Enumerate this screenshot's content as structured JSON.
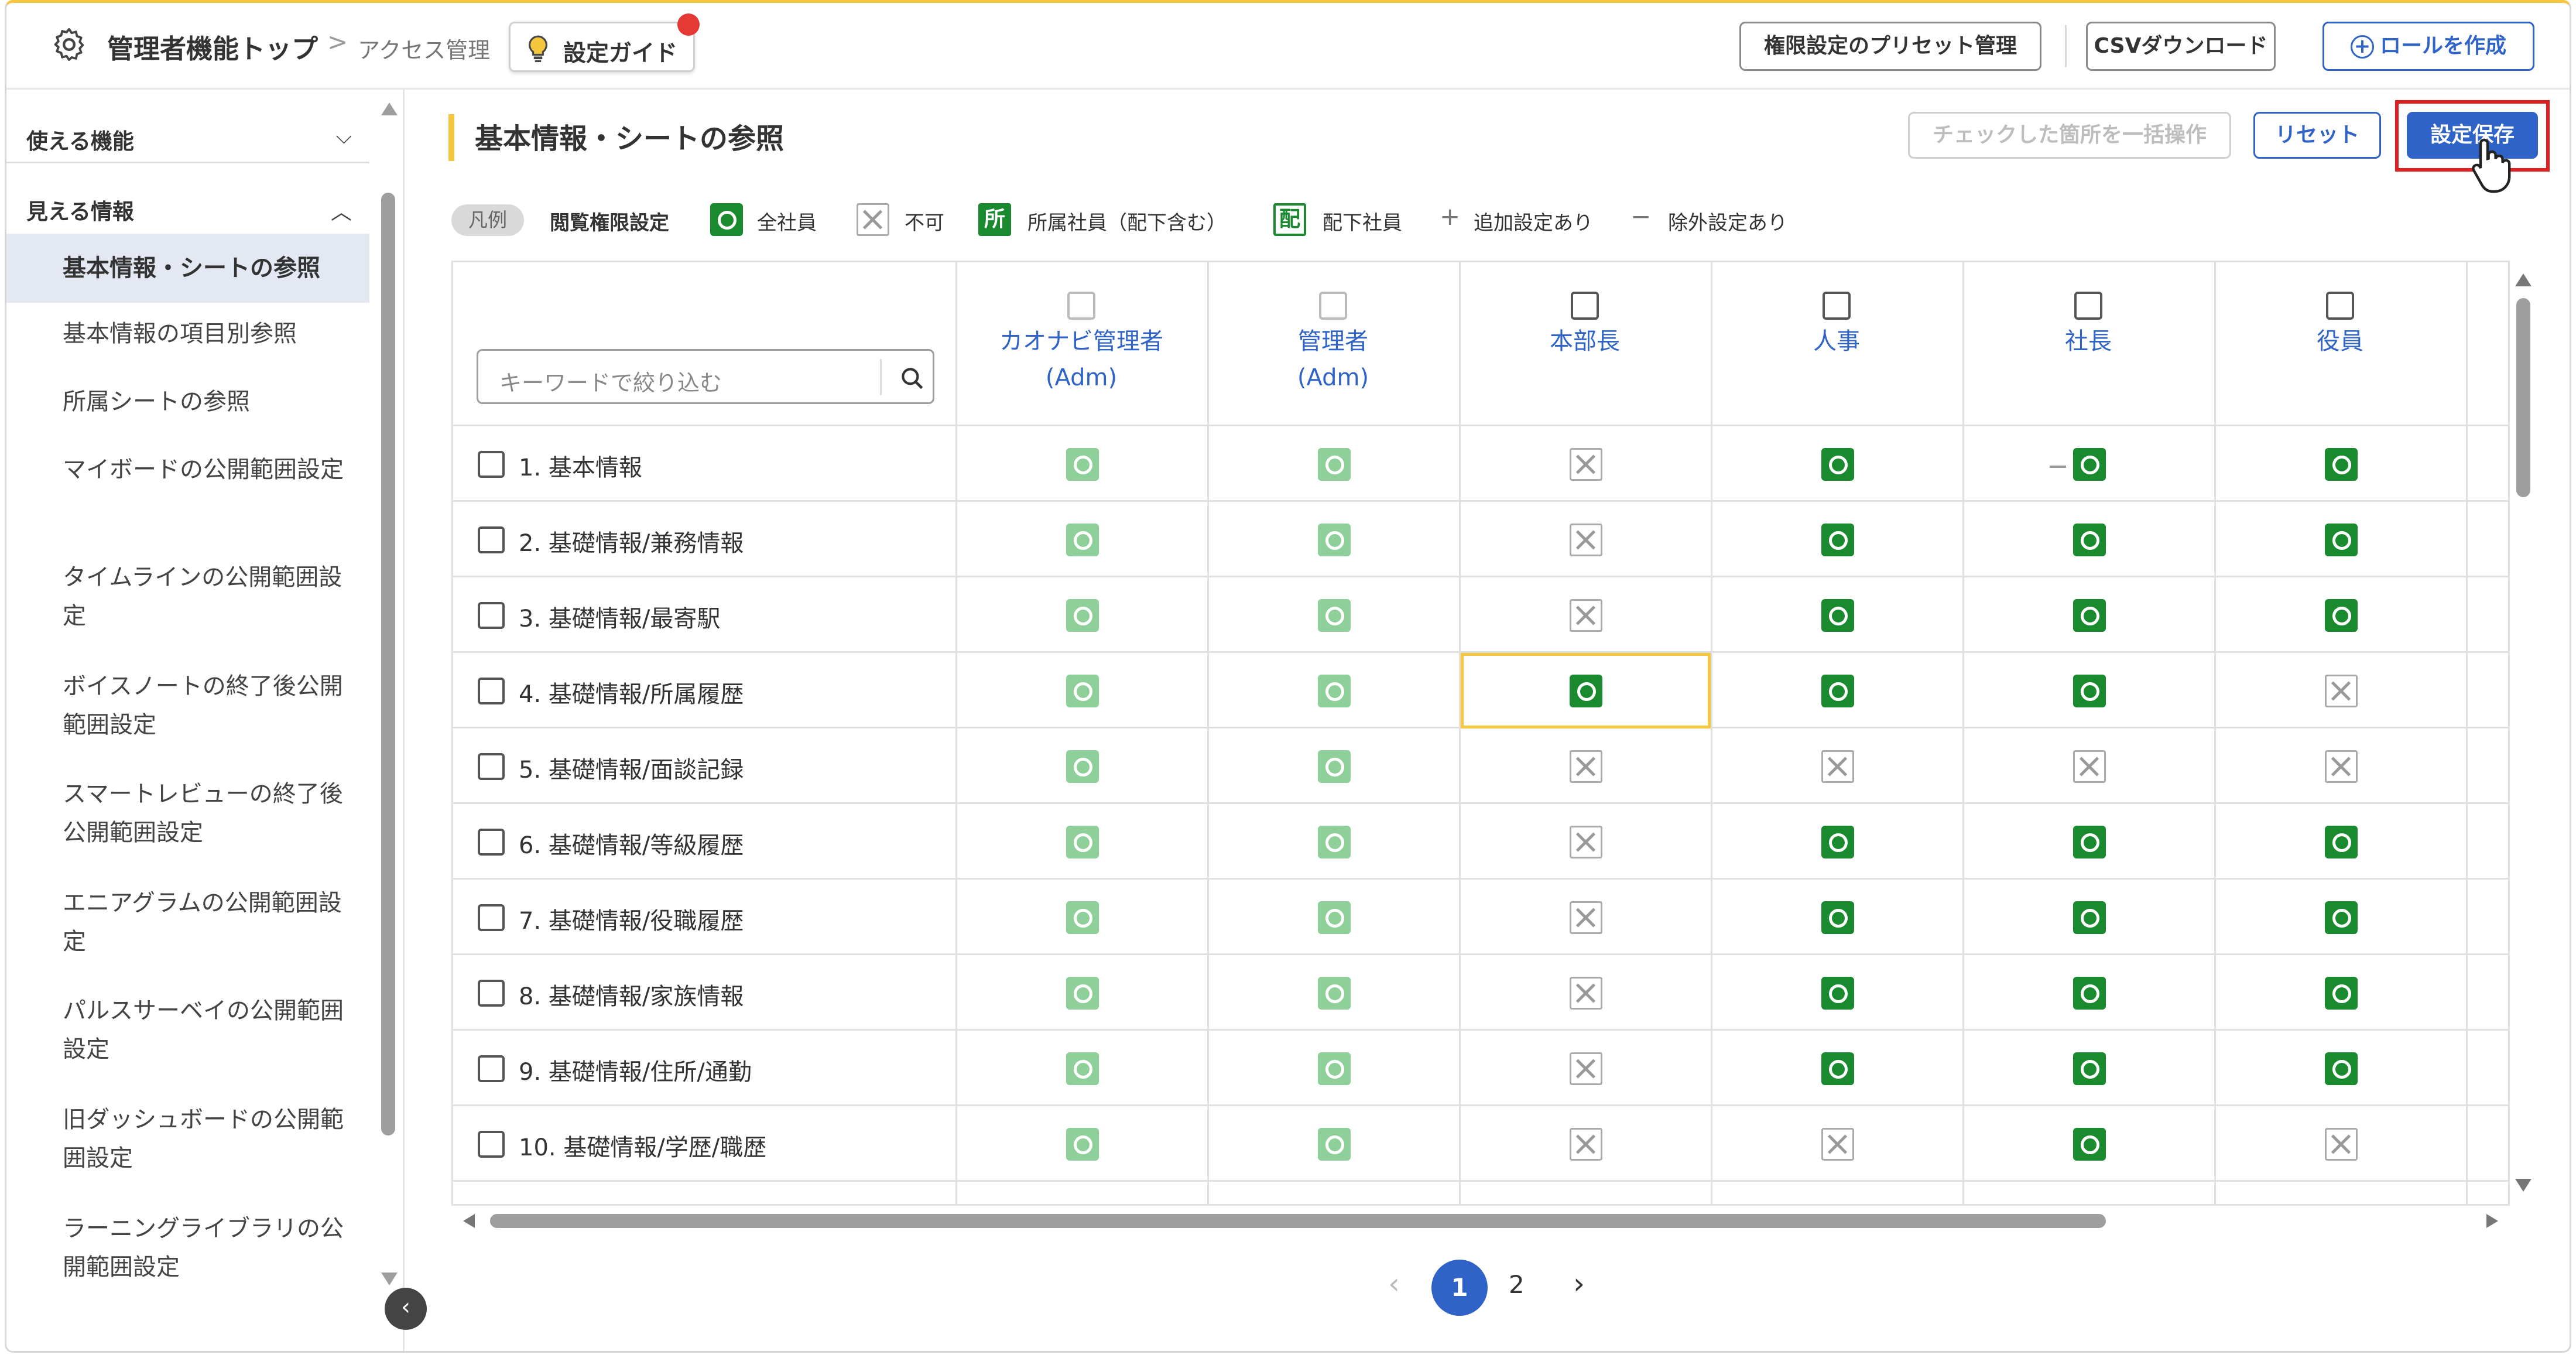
{
  "header": {
    "breadcrumb_root": "管理者機能トップ",
    "breadcrumb_sep": ">",
    "breadcrumb_current": "アクセス管理",
    "guide_label": "設定ガイド",
    "preset_label": "権限設定のプリセット管理",
    "csv_label": "CSVダウンロード",
    "create_role_label": "ロールを作成"
  },
  "sidebar": {
    "group1": "使える機能",
    "group2": "見える情報",
    "items": [
      {
        "label": "基本情報・シートの参照",
        "active": true
      },
      {
        "label": "基本情報の項目別参照"
      },
      {
        "label": "所属シートの参照"
      },
      {
        "label": "マイボードの公開範囲設定"
      },
      {
        "label": "タイムラインの公開範囲設定"
      },
      {
        "label": "ボイスノートの終了後公開範囲設定"
      },
      {
        "label": "スマートレビューの終了後公開範囲設定"
      },
      {
        "label": "エニアグラムの公開範囲設定"
      },
      {
        "label": "パルスサーベイの公開範囲設定"
      },
      {
        "label": "旧ダッシュボードの公開範囲設定"
      },
      {
        "label": "ラーニングライブラリの公開範囲設定"
      }
    ]
  },
  "main": {
    "title": "基本情報・シートの参照",
    "bulk_label": "チェックした箇所を一括操作",
    "reset_label": "リセット",
    "save_label": "設定保存"
  },
  "legend": {
    "chip": "凡例",
    "heading": "閲覧権限設定",
    "all": "全社員",
    "none": "不可",
    "dept_kanji": "所",
    "dept": "所属社員（配下含む）",
    "sub_kanji": "配",
    "sub": "配下社員",
    "plus": "+",
    "extra": "追加設定あり",
    "minus": "−",
    "exclude": "除外設定あり"
  },
  "table": {
    "search_placeholder": "キーワードで絞り込む",
    "columns": [
      {
        "name": "カオナビ管理者\n(Adm)",
        "dim": true
      },
      {
        "name": "管理者\n(Adm)",
        "dim": true
      },
      {
        "name": "本部長"
      },
      {
        "name": "人事"
      },
      {
        "name": "社長"
      },
      {
        "name": "役員"
      }
    ],
    "rows": [
      {
        "label": "1. 基本情報",
        "cells": [
          "L",
          "L",
          "X",
          "G",
          "G",
          "G"
        ]
      },
      {
        "label": "2. 基礎情報/兼務情報",
        "cells": [
          "L",
          "L",
          "X",
          "G",
          "G",
          "G"
        ]
      },
      {
        "label": "3. 基礎情報/最寄駅",
        "cells": [
          "L",
          "L",
          "X",
          "G",
          "G",
          "G"
        ]
      },
      {
        "label": "4. 基礎情報/所属履歴",
        "cells": [
          "L",
          "L",
          "G",
          "G",
          "G",
          "X"
        ]
      },
      {
        "label": "5. 基礎情報/面談記録",
        "cells": [
          "L",
          "L",
          "X",
          "X",
          "X",
          "X"
        ]
      },
      {
        "label": "6. 基礎情報/等級履歴",
        "cells": [
          "L",
          "L",
          "X",
          "G",
          "G",
          "G"
        ]
      },
      {
        "label": "7. 基礎情報/役職履歴",
        "cells": [
          "L",
          "L",
          "X",
          "G",
          "G",
          "G"
        ]
      },
      {
        "label": "8. 基礎情報/家族情報",
        "cells": [
          "L",
          "L",
          "X",
          "G",
          "G",
          "G"
        ]
      },
      {
        "label": "9. 基礎情報/住所/通勤",
        "cells": [
          "L",
          "L",
          "X",
          "G",
          "G",
          "G"
        ]
      },
      {
        "label": "10. 基礎情報/学歴/職歴",
        "cells": [
          "L",
          "L",
          "X",
          "X",
          "G",
          "X"
        ]
      }
    ]
  },
  "pagination": {
    "prev": "‹",
    "page1": "1",
    "page2": "2",
    "next": "›"
  },
  "colors": {
    "accent": "#2f63c8",
    "ok": "#1a8a2f",
    "ok_light": "#8fcf9a",
    "highlight": "#f4c73e",
    "alert": "#e02020"
  }
}
